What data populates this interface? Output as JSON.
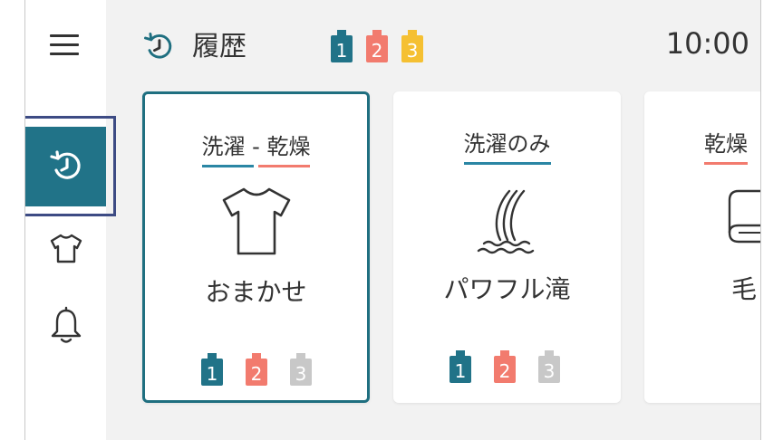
{
  "header": {
    "title": "履歴",
    "time": "10:00",
    "tanks": [
      {
        "label": "1",
        "color": "#217388"
      },
      {
        "label": "2",
        "color": "#f27b6e"
      },
      {
        "label": "3",
        "color": "#f5c032"
      }
    ]
  },
  "sidebar": {
    "items": [
      {
        "name": "history",
        "icon": "history-icon"
      },
      {
        "name": "clothes",
        "icon": "tshirt-icon"
      },
      {
        "name": "notifications",
        "icon": "bell-icon"
      }
    ]
  },
  "cards": [
    {
      "mode": "洗濯 - 乾燥",
      "mode_part1": "洗濯",
      "mode_sep": " - ",
      "mode_part2": "乾燥",
      "icon": "tshirt-icon",
      "name": "おまかせ",
      "tanks": [
        {
          "label": "1",
          "color": "#217388"
        },
        {
          "label": "2",
          "color": "#f27b6e"
        },
        {
          "label": "3",
          "color": "#c8c8c8"
        }
      ]
    },
    {
      "mode": "洗濯のみ",
      "icon": "waterfall-icon",
      "name": "パワフル滝",
      "tanks": [
        {
          "label": "1",
          "color": "#217388"
        },
        {
          "label": "2",
          "color": "#f27b6e"
        },
        {
          "label": "3",
          "color": "#c8c8c8"
        }
      ]
    },
    {
      "mode": "乾燥",
      "icon": "blanket-icon",
      "name": "毛"
    }
  ],
  "colors": {
    "accent": "#217388",
    "wash_underline": "#2a86a4",
    "dry_underline": "#f27b6e"
  }
}
